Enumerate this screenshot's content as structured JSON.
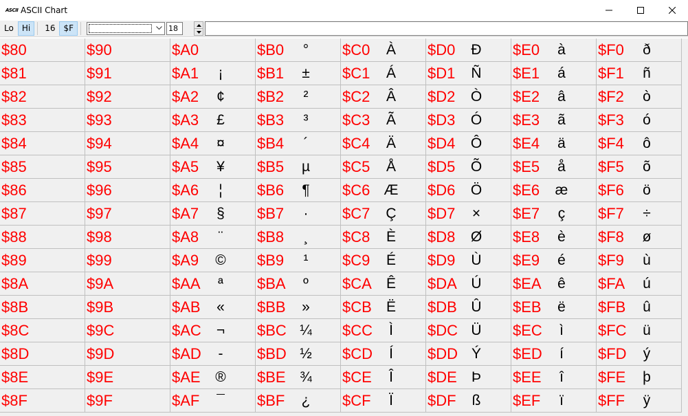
{
  "window": {
    "app_icon_text": "ASCII",
    "title": "ASCII Chart"
  },
  "toolbar": {
    "lo_label": "Lo",
    "hi_label": "Hi",
    "base16_label": "16",
    "hexprefix_label": "$F",
    "font_size_value": "18",
    "font_combo_value": "",
    "text_value": ""
  },
  "chart": {
    "columns": [
      {
        "cells": [
          {
            "code": "$80",
            "glyph": ""
          },
          {
            "code": "$81",
            "glyph": ""
          },
          {
            "code": "$82",
            "glyph": ""
          },
          {
            "code": "$83",
            "glyph": ""
          },
          {
            "code": "$84",
            "glyph": ""
          },
          {
            "code": "$85",
            "glyph": ""
          },
          {
            "code": "$86",
            "glyph": ""
          },
          {
            "code": "$87",
            "glyph": ""
          },
          {
            "code": "$88",
            "glyph": ""
          },
          {
            "code": "$89",
            "glyph": ""
          },
          {
            "code": "$8A",
            "glyph": ""
          },
          {
            "code": "$8B",
            "glyph": ""
          },
          {
            "code": "$8C",
            "glyph": ""
          },
          {
            "code": "$8D",
            "glyph": ""
          },
          {
            "code": "$8E",
            "glyph": ""
          },
          {
            "code": "$8F",
            "glyph": ""
          }
        ]
      },
      {
        "cells": [
          {
            "code": "$90",
            "glyph": ""
          },
          {
            "code": "$91",
            "glyph": ""
          },
          {
            "code": "$92",
            "glyph": ""
          },
          {
            "code": "$93",
            "glyph": ""
          },
          {
            "code": "$94",
            "glyph": ""
          },
          {
            "code": "$95",
            "glyph": ""
          },
          {
            "code": "$96",
            "glyph": ""
          },
          {
            "code": "$97",
            "glyph": ""
          },
          {
            "code": "$98",
            "glyph": ""
          },
          {
            "code": "$99",
            "glyph": ""
          },
          {
            "code": "$9A",
            "glyph": ""
          },
          {
            "code": "$9B",
            "glyph": ""
          },
          {
            "code": "$9C",
            "glyph": ""
          },
          {
            "code": "$9D",
            "glyph": ""
          },
          {
            "code": "$9E",
            "glyph": ""
          },
          {
            "code": "$9F",
            "glyph": ""
          }
        ]
      },
      {
        "cells": [
          {
            "code": "$A0",
            "glyph": ""
          },
          {
            "code": "$A1",
            "glyph": "¡"
          },
          {
            "code": "$A2",
            "glyph": "¢"
          },
          {
            "code": "$A3",
            "glyph": "£"
          },
          {
            "code": "$A4",
            "glyph": "¤"
          },
          {
            "code": "$A5",
            "glyph": "¥"
          },
          {
            "code": "$A6",
            "glyph": "¦"
          },
          {
            "code": "$A7",
            "glyph": "§"
          },
          {
            "code": "$A8",
            "glyph": "¨"
          },
          {
            "code": "$A9",
            "glyph": "©"
          },
          {
            "code": "$AA",
            "glyph": "ª"
          },
          {
            "code": "$AB",
            "glyph": "«"
          },
          {
            "code": "$AC",
            "glyph": "¬"
          },
          {
            "code": "$AD",
            "glyph": "-"
          },
          {
            "code": "$AE",
            "glyph": "®"
          },
          {
            "code": "$AF",
            "glyph": "¯"
          }
        ]
      },
      {
        "cells": [
          {
            "code": "$B0",
            "glyph": "°"
          },
          {
            "code": "$B1",
            "glyph": "±"
          },
          {
            "code": "$B2",
            "glyph": "²"
          },
          {
            "code": "$B3",
            "glyph": "³"
          },
          {
            "code": "$B4",
            "glyph": "´"
          },
          {
            "code": "$B5",
            "glyph": "µ"
          },
          {
            "code": "$B6",
            "glyph": "¶"
          },
          {
            "code": "$B7",
            "glyph": "·"
          },
          {
            "code": "$B8",
            "glyph": "¸"
          },
          {
            "code": "$B9",
            "glyph": "¹"
          },
          {
            "code": "$BA",
            "glyph": "º"
          },
          {
            "code": "$BB",
            "glyph": "»"
          },
          {
            "code": "$BC",
            "glyph": "¼"
          },
          {
            "code": "$BD",
            "glyph": "½"
          },
          {
            "code": "$BE",
            "glyph": "¾"
          },
          {
            "code": "$BF",
            "glyph": "¿"
          }
        ]
      },
      {
        "cells": [
          {
            "code": "$C0",
            "glyph": "À"
          },
          {
            "code": "$C1",
            "glyph": "Á"
          },
          {
            "code": "$C2",
            "glyph": "Â"
          },
          {
            "code": "$C3",
            "glyph": "Ã"
          },
          {
            "code": "$C4",
            "glyph": "Ä"
          },
          {
            "code": "$C5",
            "glyph": "Å"
          },
          {
            "code": "$C6",
            "glyph": "Æ"
          },
          {
            "code": "$C7",
            "glyph": "Ç"
          },
          {
            "code": "$C8",
            "glyph": "È"
          },
          {
            "code": "$C9",
            "glyph": "É"
          },
          {
            "code": "$CA",
            "glyph": "Ê"
          },
          {
            "code": "$CB",
            "glyph": "Ë"
          },
          {
            "code": "$CC",
            "glyph": "Ì"
          },
          {
            "code": "$CD",
            "glyph": "Í"
          },
          {
            "code": "$CE",
            "glyph": "Î"
          },
          {
            "code": "$CF",
            "glyph": "Ï"
          }
        ]
      },
      {
        "cells": [
          {
            "code": "$D0",
            "glyph": "Ð"
          },
          {
            "code": "$D1",
            "glyph": "Ñ"
          },
          {
            "code": "$D2",
            "glyph": "Ò"
          },
          {
            "code": "$D3",
            "glyph": "Ó"
          },
          {
            "code": "$D4",
            "glyph": "Ô"
          },
          {
            "code": "$D5",
            "glyph": "Õ"
          },
          {
            "code": "$D6",
            "glyph": "Ö"
          },
          {
            "code": "$D7",
            "glyph": "×"
          },
          {
            "code": "$D8",
            "glyph": "Ø"
          },
          {
            "code": "$D9",
            "glyph": "Ù"
          },
          {
            "code": "$DA",
            "glyph": "Ú"
          },
          {
            "code": "$DB",
            "glyph": "Û"
          },
          {
            "code": "$DC",
            "glyph": "Ü"
          },
          {
            "code": "$DD",
            "glyph": "Ý"
          },
          {
            "code": "$DE",
            "glyph": "Þ"
          },
          {
            "code": "$DF",
            "glyph": "ß"
          }
        ]
      },
      {
        "cells": [
          {
            "code": "$E0",
            "glyph": "à"
          },
          {
            "code": "$E1",
            "glyph": "á"
          },
          {
            "code": "$E2",
            "glyph": "â"
          },
          {
            "code": "$E3",
            "glyph": "ã"
          },
          {
            "code": "$E4",
            "glyph": "ä"
          },
          {
            "code": "$E5",
            "glyph": "å"
          },
          {
            "code": "$E6",
            "glyph": "æ"
          },
          {
            "code": "$E7",
            "glyph": "ç"
          },
          {
            "code": "$E8",
            "glyph": "è"
          },
          {
            "code": "$E9",
            "glyph": "é"
          },
          {
            "code": "$EA",
            "glyph": "ê"
          },
          {
            "code": "$EB",
            "glyph": "ë"
          },
          {
            "code": "$EC",
            "glyph": "ì"
          },
          {
            "code": "$ED",
            "glyph": "í"
          },
          {
            "code": "$EE",
            "glyph": "î"
          },
          {
            "code": "$EF",
            "glyph": "ï"
          }
        ]
      },
      {
        "cells": [
          {
            "code": "$F0",
            "glyph": "ð"
          },
          {
            "code": "$F1",
            "glyph": "ñ"
          },
          {
            "code": "$F2",
            "glyph": "ò"
          },
          {
            "code": "$F3",
            "glyph": "ó"
          },
          {
            "code": "$F4",
            "glyph": "ô"
          },
          {
            "code": "$F5",
            "glyph": "õ"
          },
          {
            "code": "$F6",
            "glyph": "ö"
          },
          {
            "code": "$F7",
            "glyph": "÷"
          },
          {
            "code": "$F8",
            "glyph": "ø"
          },
          {
            "code": "$F9",
            "glyph": "ù"
          },
          {
            "code": "$FA",
            "glyph": "ú"
          },
          {
            "code": "$FB",
            "glyph": "û"
          },
          {
            "code": "$FC",
            "glyph": "ü"
          },
          {
            "code": "$FD",
            "glyph": "ý"
          },
          {
            "code": "$FE",
            "glyph": "þ"
          },
          {
            "code": "$FF",
            "glyph": "ÿ"
          }
        ]
      }
    ]
  },
  "colors": {
    "code_text": "#ff0000",
    "glyph_text": "#000000",
    "cell_bg": "#f0f0f0",
    "active_button_bg": "#cce4f7"
  },
  "icons": {
    "minimize": "minimize-icon",
    "maximize": "maximize-icon",
    "close": "close-icon",
    "combo_arrow": "chevron-down-icon",
    "spin_up": "spin-up-icon",
    "spin_down": "spin-down-icon"
  }
}
